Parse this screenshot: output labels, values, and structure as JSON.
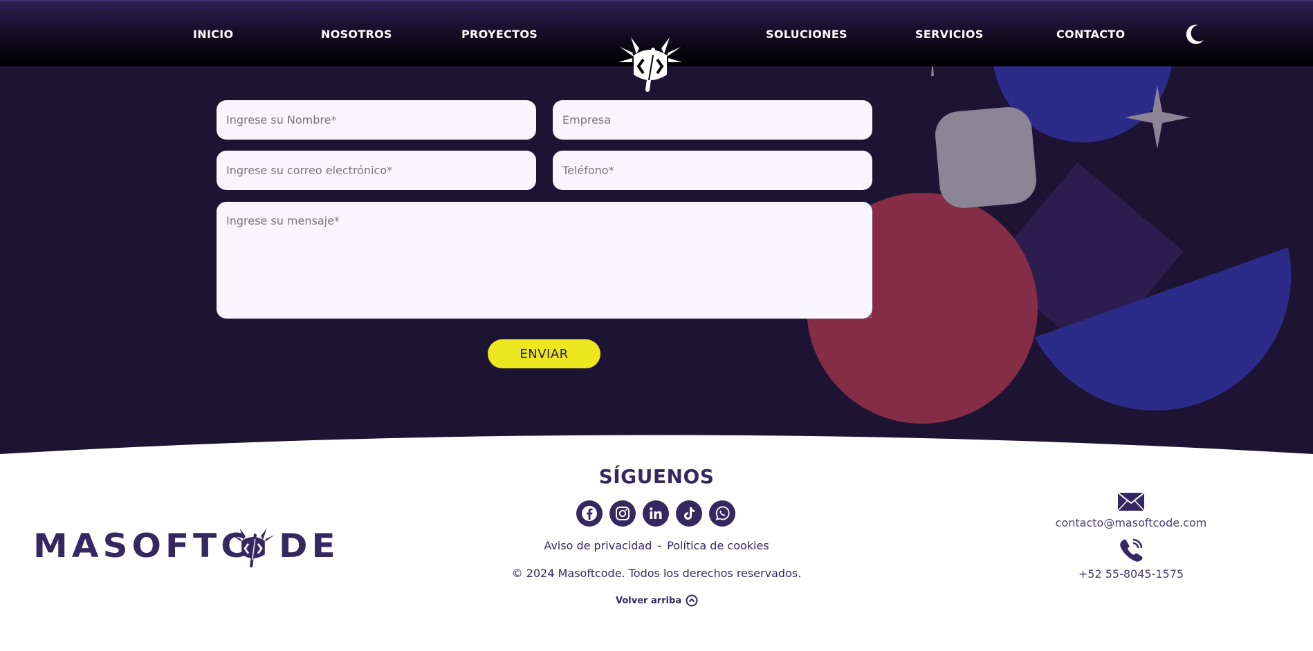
{
  "nav": {
    "left_links": [
      "INICIO",
      "NOSOTROS",
      "PROYECTOS"
    ],
    "right_links": [
      "SOLUCIONES",
      "SERVICIOS",
      "CONTACTO"
    ],
    "theme_toggle_icon": "moon-icon",
    "logo_icon": "axolotl-code-logo-icon"
  },
  "form": {
    "name_placeholder": "Ingrese su Nombre*",
    "company_placeholder": "Empresa",
    "email_placeholder": "Ingrese su correo electrónico*",
    "phone_placeholder": "Teléfono*",
    "message_placeholder": "Ingrese su mensaje*",
    "submit_label": "ENVIAR"
  },
  "footer": {
    "brand_left": "MASOFTC",
    "brand_right": "DE",
    "follow_title": "SÍGUENOS",
    "social": [
      "facebook-icon",
      "instagram-icon",
      "linkedin-icon",
      "tiktok-icon",
      "whatsapp-icon"
    ],
    "privacy_label": "Aviso de privacidad",
    "separator": "-",
    "cookies_label": "Política de cookies",
    "copyright": "© 2024 Masoftcode. Todos los derechos reservados.",
    "back_to_top": "Volver arriba",
    "email": "contacto@masoftcode.com",
    "phone": "+52 55-8045-1575"
  },
  "colors": {
    "background": "#1d1433",
    "accent_yellow": "#eee71f",
    "brand_purple": "#35275f",
    "shape_red": "#852c46",
    "shape_blue": "#2d2b8a",
    "shape_violet": "#2c1d4f",
    "shape_gray": "#8c8597"
  }
}
